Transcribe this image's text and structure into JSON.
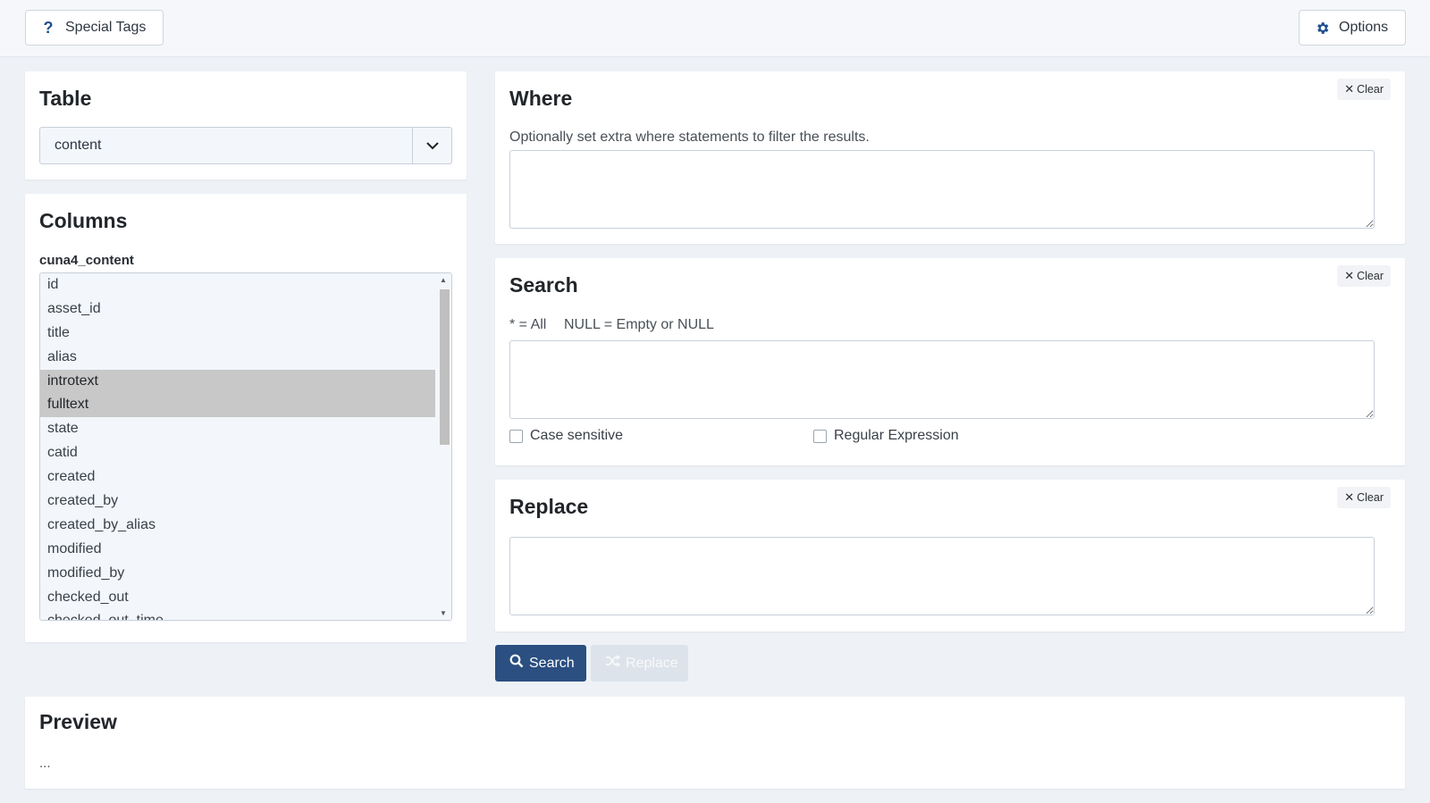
{
  "topbar": {
    "special_tags_label": "Special Tags",
    "options_label": "Options"
  },
  "table": {
    "title": "Table",
    "selected": "content"
  },
  "columns": {
    "title": "Columns",
    "group_label": "cuna4_content",
    "items": [
      "id",
      "asset_id",
      "title",
      "alias",
      "introtext",
      "fulltext",
      "state",
      "catid",
      "created",
      "created_by",
      "created_by_alias",
      "modified",
      "modified_by",
      "checked_out",
      "checked_out_time"
    ],
    "selected": [
      "introtext",
      "fulltext"
    ]
  },
  "where": {
    "title": "Where",
    "clear_label": "Clear",
    "help": "Optionally set extra where statements to filter the results.",
    "value": ""
  },
  "search": {
    "title": "Search",
    "clear_label": "Clear",
    "hint_all": "* = All",
    "hint_null": "NULL = Empty or NULL",
    "value": "",
    "case_sensitive_label": "Case sensitive",
    "case_sensitive": false,
    "regex_label": "Regular Expression",
    "regex": false
  },
  "replace": {
    "title": "Replace",
    "clear_label": "Clear",
    "value": ""
  },
  "actions": {
    "search_label": "Search",
    "replace_label": "Replace"
  },
  "preview": {
    "title": "Preview",
    "text": "..."
  },
  "colors": {
    "primary": "#2a4f80",
    "disabled": "#dde3ea",
    "selected_row": "#c8c8c8"
  }
}
